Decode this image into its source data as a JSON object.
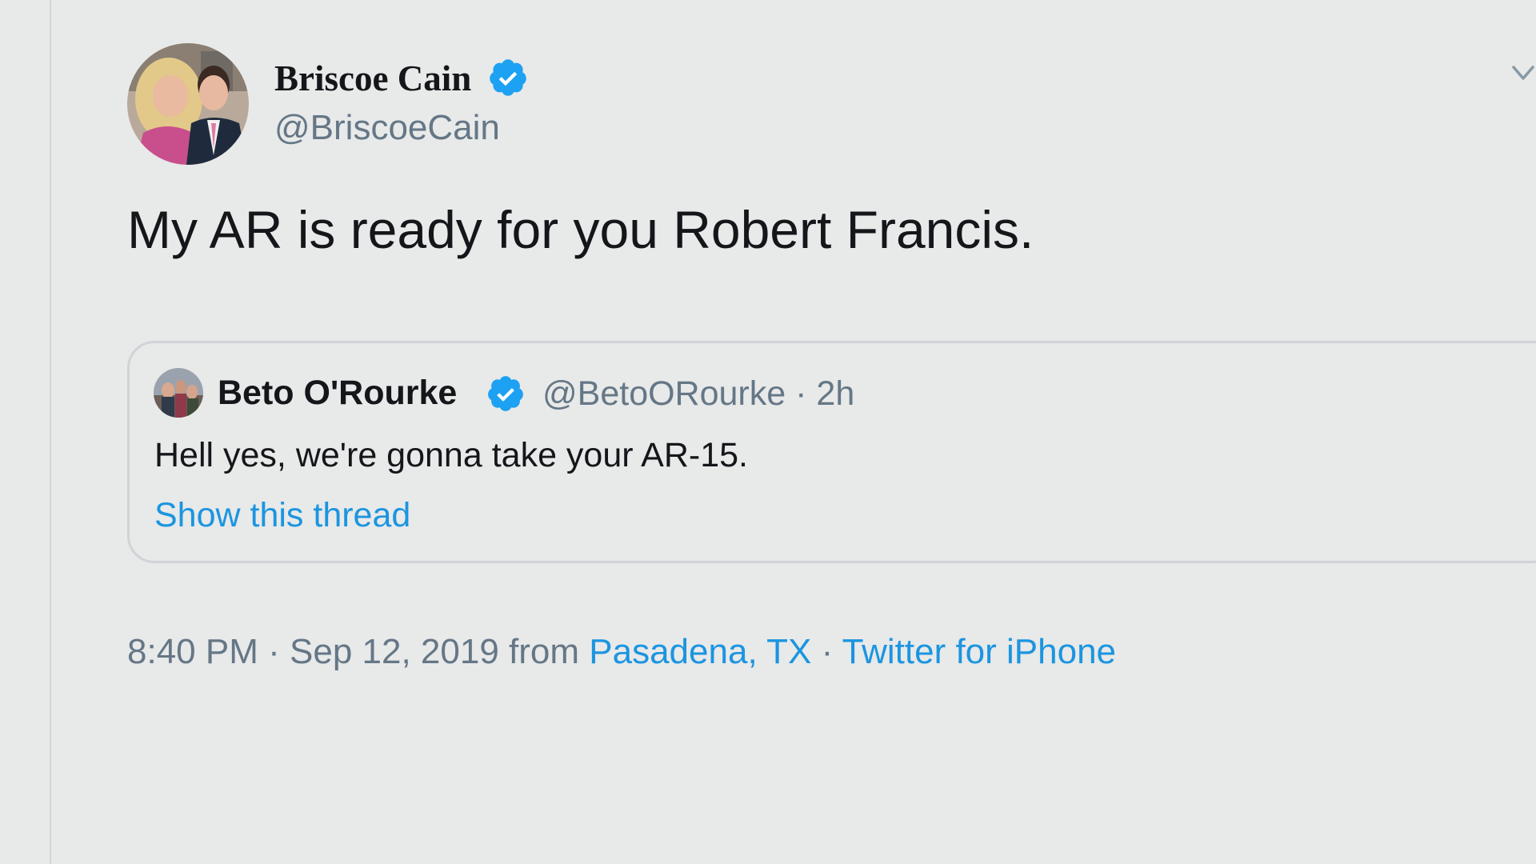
{
  "tweet": {
    "author_name": "Briscoe Cain",
    "author_handle": "@BriscoeCain",
    "verified_icon": "verified-badge-icon",
    "menu_icon": "chevron-down-icon",
    "text": "My AR is ready for you Robert Francis.",
    "time": "8:40 PM",
    "meta_separator": "·",
    "date": "Sep 12, 2019",
    "from_label": "from",
    "location": "Pasadena, TX",
    "source": "Twitter for iPhone"
  },
  "quoted_tweet": {
    "author_name": "Beto O'Rourke",
    "author_handle": "@BetoORourke",
    "meta_separator": "·",
    "time_ago": "2h",
    "text": "Hell yes, we're gonna take your AR-15.",
    "show_thread": "Show this thread"
  },
  "colors": {
    "background": "#e8e9e9",
    "link_blue": "#1b95e0",
    "verified_blue": "#1da1f2",
    "secondary_text": "#657786",
    "primary_text": "#14171a"
  }
}
